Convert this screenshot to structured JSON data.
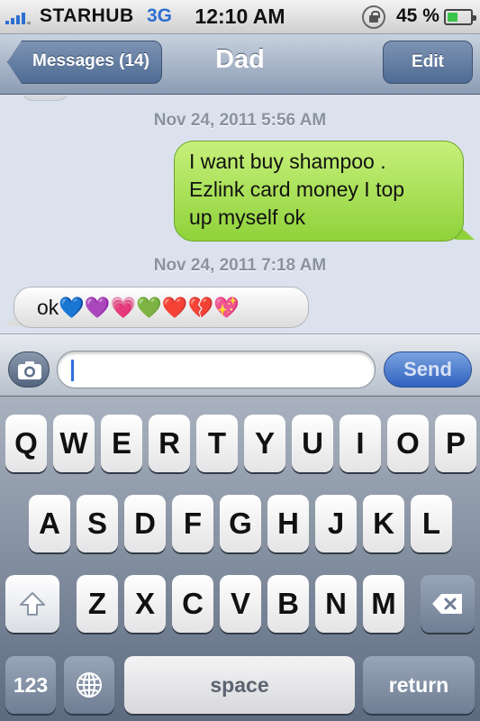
{
  "status_bar": {
    "carrier": "STARHUB",
    "network": "3G",
    "time": "12:10 AM",
    "battery_text": "45 %",
    "battery_level": 0.45,
    "signal_icon": "signal-bars-icon",
    "lock_icon": "rotation-lock-icon",
    "battery_icon": "battery-icon"
  },
  "nav": {
    "back_label": "Messages (14)",
    "title": "Dad",
    "edit_label": "Edit"
  },
  "messages": [
    {
      "timestamp": "Nov 24, 2011 5:56 AM",
      "direction": "outgoing",
      "text": "I want buy shampoo .\nEzlink card money I top\nup myself ok"
    },
    {
      "timestamp": "Nov 24, 2011 7:18 AM",
      "direction": "incoming",
      "text": "ok💙💜💗💚❤️💔💖"
    }
  ],
  "composer": {
    "placeholder": "",
    "send_label": "Send",
    "camera_icon": "camera-icon"
  },
  "keyboard": {
    "row1": [
      "Q",
      "W",
      "E",
      "R",
      "T",
      "Y",
      "U",
      "I",
      "O",
      "P"
    ],
    "row2": [
      "A",
      "S",
      "D",
      "F",
      "G",
      "H",
      "J",
      "K",
      "L"
    ],
    "row3": [
      "Z",
      "X",
      "C",
      "V",
      "B",
      "N",
      "M"
    ],
    "numbers_label": "123",
    "space_label": "space",
    "return_label": "return",
    "shift_icon": "shift-icon",
    "delete_icon": "backspace-icon",
    "globe_icon": "globe-icon"
  },
  "colors": {
    "outgoing_bubble": "#8fd23a",
    "send_button": "#2f61c0",
    "network": "#2d6fd1"
  }
}
